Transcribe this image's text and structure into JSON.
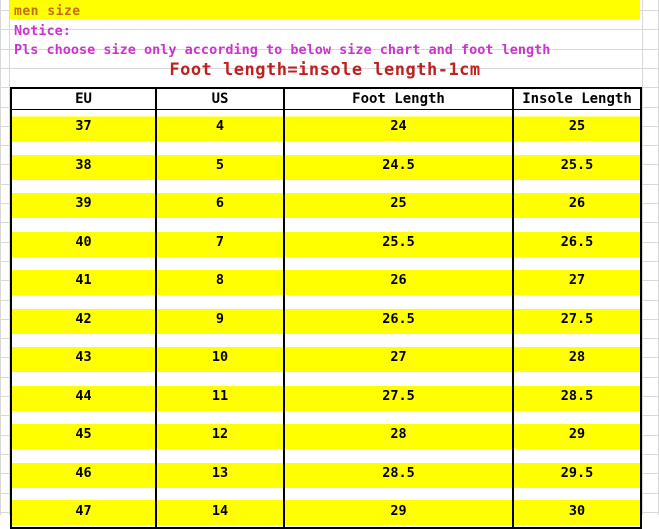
{
  "banner": {
    "label": "men size",
    "background_color": "#ffff00",
    "text_color": "#c46a13"
  },
  "notice": {
    "heading": "Notice:",
    "line": "Pls choose size only according to below size chart and foot length",
    "text_color": "#cc33cc"
  },
  "formula": {
    "text": "Foot length=insole length-1cm",
    "text_color": "#c02020"
  },
  "table": {
    "headers": [
      "EU",
      "US",
      "Foot Length",
      "Insole Length"
    ],
    "row_highlight_color": "#ffff00",
    "border_color": "#000000",
    "rows": [
      [
        "37",
        "4",
        "24",
        "25"
      ],
      [
        "38",
        "5",
        "24.5",
        "25.5"
      ],
      [
        "39",
        "6",
        "25",
        "26"
      ],
      [
        "40",
        "7",
        "25.5",
        "26.5"
      ],
      [
        "41",
        "8",
        "26",
        "27"
      ],
      [
        "42",
        "9",
        "26.5",
        "27.5"
      ],
      [
        "43",
        "10",
        "27",
        "28"
      ],
      [
        "44",
        "11",
        "27.5",
        "28.5"
      ],
      [
        "45",
        "12",
        "28",
        "29"
      ],
      [
        "46",
        "13",
        "28.5",
        "29.5"
      ],
      [
        "47",
        "14",
        "29",
        "30"
      ]
    ]
  }
}
